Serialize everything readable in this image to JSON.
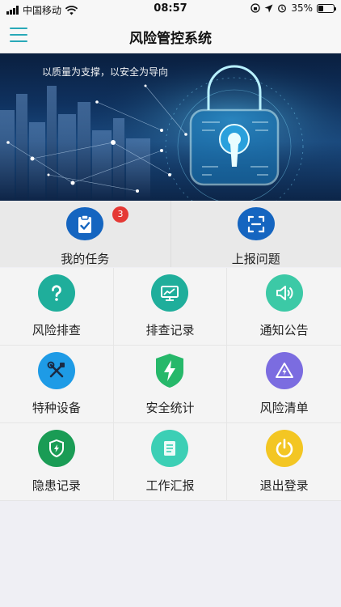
{
  "status_bar": {
    "carrier": "中国移动",
    "time": "08:57",
    "battery": "35%",
    "battery_level": 0.35
  },
  "header": {
    "title": "风险管控系统"
  },
  "banner": {
    "slogan": "以质量为支撑，以安全为导向"
  },
  "top_actions": [
    {
      "label": "我的任务",
      "icon": "clipboard-check-icon",
      "badge": "3",
      "color": "#1565c0"
    },
    {
      "label": "上报问题",
      "icon": "scan-frame-icon",
      "color": "#1565c0"
    }
  ],
  "grid": [
    {
      "label": "风险排查",
      "icon": "question-icon",
      "color": "#1fae9b"
    },
    {
      "label": "排查记录",
      "icon": "monitor-chart-icon",
      "color": "#1fae9b"
    },
    {
      "label": "通知公告",
      "icon": "speaker-icon",
      "color": "#3cc9a6"
    },
    {
      "label": "特种设备",
      "icon": "tools-icon",
      "color": "#1e9be6"
    },
    {
      "label": "安全统计",
      "icon": "shield-bolt-icon",
      "color": "#26b86a"
    },
    {
      "label": "风险清单",
      "icon": "warning-triangle-icon",
      "color": "#7b6ce0"
    },
    {
      "label": "隐患记录",
      "icon": "shield-bolt-icon",
      "color": "#1a9c55"
    },
    {
      "label": "工作汇报",
      "icon": "document-icon",
      "color": "#3ccfb5"
    },
    {
      "label": "退出登录",
      "icon": "power-icon",
      "color": "#f3c623"
    }
  ]
}
